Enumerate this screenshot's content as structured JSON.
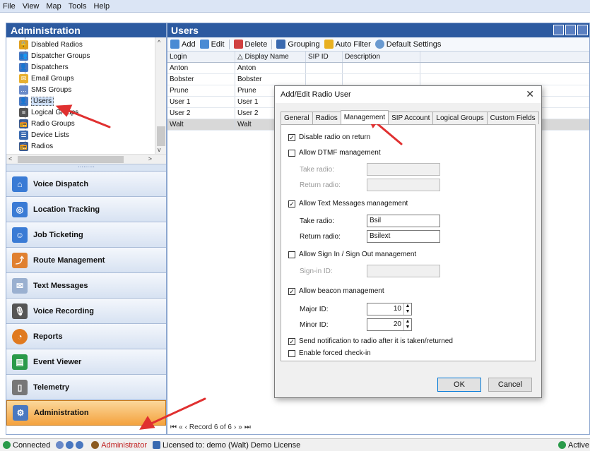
{
  "menu": [
    "File",
    "View",
    "Map",
    "Tools",
    "Help"
  ],
  "left": {
    "title": "Administration",
    "tree": [
      {
        "label": "Disabled Radios",
        "icon": "lock-icon",
        "color": "#e0a020"
      },
      {
        "label": "Dispatcher Groups",
        "icon": "group-icon",
        "color": "#4a78c0"
      },
      {
        "label": "Dispatchers",
        "icon": "dispatcher-icon",
        "color": "#4a78c0"
      },
      {
        "label": "Email Groups",
        "icon": "email-icon",
        "color": "#e8b030"
      },
      {
        "label": "SMS Groups",
        "icon": "sms-icon",
        "color": "#6a8ac8"
      },
      {
        "label": "Users",
        "icon": "users-icon",
        "color": "#4a78c0"
      },
      {
        "label": "Logical Groups",
        "icon": "list-icon",
        "color": "#555555"
      },
      {
        "label": "Radio Groups",
        "icon": "radio-group-icon",
        "color": "#3a5a90"
      },
      {
        "label": "Device Lists",
        "icon": "device-list-icon",
        "color": "#3a6ab0"
      },
      {
        "label": "Radios",
        "icon": "radio-icon",
        "color": "#3a5a90"
      }
    ],
    "nav": [
      {
        "label": "Voice Dispatch",
        "icon": "voice-dispatch-icon",
        "color": "#3a7bd5"
      },
      {
        "label": "Location Tracking",
        "icon": "location-icon",
        "color": "#3a7bd5"
      },
      {
        "label": "Job Ticketing",
        "icon": "job-icon",
        "color": "#3a7bd5"
      },
      {
        "label": "Route Management",
        "icon": "route-icon",
        "color": "#e08030"
      },
      {
        "label": "Text Messages",
        "icon": "envelope-icon",
        "color": "#9ab0d0"
      },
      {
        "label": "Voice Recording",
        "icon": "microphone-icon",
        "color": "#555555"
      },
      {
        "label": "Reports",
        "icon": "reports-icon",
        "color": "#e07a20"
      },
      {
        "label": "Event Viewer",
        "icon": "event-icon",
        "color": "#2a9a4a"
      },
      {
        "label": "Telemetry",
        "icon": "telemetry-icon",
        "color": "#777777"
      },
      {
        "label": "Administration",
        "icon": "admin-icon",
        "color": "#4a78c0"
      }
    ]
  },
  "users": {
    "title": "Users",
    "toolbar": {
      "add": "Add",
      "edit": "Edit",
      "delete": "Delete",
      "grouping": "Grouping",
      "auto_filter": "Auto Filter",
      "default_settings": "Default Settings"
    },
    "columns": [
      "Login",
      "Display Name",
      "SIP ID",
      "Description"
    ],
    "rows": [
      [
        "Anton",
        "Anton",
        "",
        ""
      ],
      [
        "Bobster",
        "Bobster",
        "",
        ""
      ],
      [
        "Prune",
        "Prune",
        "",
        ""
      ],
      [
        "User 1",
        "User 1",
        "",
        ""
      ],
      [
        "User 2",
        "User 2",
        "",
        ""
      ],
      [
        "Walt",
        "Walt",
        "",
        ""
      ]
    ],
    "record_text": "Record 6 of 6"
  },
  "dialog": {
    "title": "Add/Edit Radio User",
    "tabs": [
      "General",
      "Radios",
      "Management",
      "SIP Account",
      "Logical Groups",
      "Custom Fields"
    ],
    "disable_radio_on_return": "Disable radio on return",
    "allow_dtmf": "Allow DTMF management",
    "take_radio": "Take radio:",
    "return_radio": "Return radio:",
    "allow_text": "Allow Text Messages management",
    "text_take_value": "Bsil",
    "text_return_value": "Bsilext",
    "allow_signin": "Allow Sign In / Sign Out management",
    "signin_id": "Sign-in ID:",
    "allow_beacon": "Allow beacon management",
    "major_id": "Major ID:",
    "major_value": "10",
    "minor_id": "Minor ID:",
    "minor_value": "20",
    "send_notification": "Send notification to radio after it is taken/returned",
    "forced_checkin": "Enable forced check-in",
    "ok": "OK",
    "cancel": "Cancel"
  },
  "status": {
    "connected": "Connected",
    "role": "Administrator",
    "license": "Licensed to: demo (Walt) Demo License",
    "active": "Active"
  }
}
